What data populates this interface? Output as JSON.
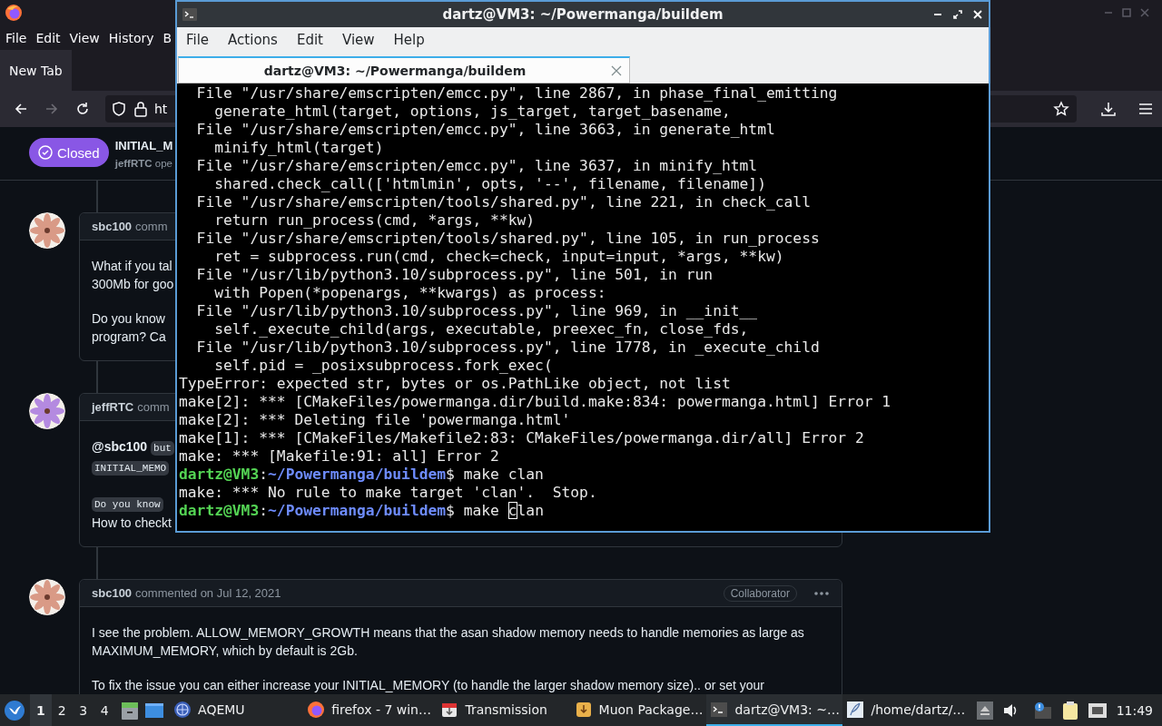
{
  "browser": {
    "menu": [
      "File",
      "Edit",
      "View",
      "History",
      "B"
    ],
    "tab": {
      "label": "New Tab",
      "selected": true
    },
    "nav": [
      {
        "kind": "back",
        "disabled": false
      },
      {
        "kind": "forward",
        "disabled": true
      },
      {
        "kind": "reload",
        "disabled": false
      }
    ],
    "address": {
      "value": "ht"
    },
    "issue": {
      "status": "Closed",
      "title": "INITIAL_M",
      "author": "jeffRTC",
      "meta": "ope"
    },
    "comments": [
      {
        "author": "sbc100",
        "action": "comm",
        "color": "#d99a86",
        "paragraphs": [
          [
            [
              {
                "kind": "text",
                "text": "What if you tal"
              }
            ],
            [
              {
                "kind": "text",
                "text": "300Mb for goo"
              }
            ]
          ],
          [
            [
              {
                "kind": "text",
                "text": "Do you know"
              }
            ],
            [
              {
                "kind": "text",
                "text": "program? Ca"
              }
            ]
          ]
        ]
      },
      {
        "author": "jeffRTC",
        "action": "comm",
        "color": "#b48ae0",
        "paragraphs": [
          [
            [
              {
                "kind": "mention",
                "text": "@sbc100"
              },
              {
                "kind": "code",
                "text": "but"
              }
            ],
            [
              {
                "kind": "code",
                "text": "INITIAL_MEMO"
              }
            ]
          ],
          [
            [
              {
                "kind": "code",
                "text": "Do you know"
              }
            ],
            [
              {
                "kind": "text",
                "text": "How to checkt"
              }
            ]
          ]
        ]
      },
      {
        "author": "sbc100",
        "action": "commented on Jul 12, 2021",
        "badge": "Collaborator",
        "color": "#d99a86",
        "paragraphs": [
          [
            [
              {
                "kind": "text",
                "text": "I see the problem. ALLOW_MEMORY_GROWTH means that the asan shadow memory needs to handle memories as large as"
              }
            ],
            [
              {
                "kind": "text",
                "text": "MAXIMUM_MEMORY, which by default is 2Gb."
              }
            ]
          ],
          [
            [
              {
                "kind": "text",
                "text": "To fix the issue you can either increase your INITIAL_MEMORY (to handle the larger shadow memory size).. or set your"
              }
            ]
          ]
        ]
      }
    ]
  },
  "terminal": {
    "title": "dartz@VM3: ~/Powermanga/buildem",
    "menu": [
      "File",
      "Actions",
      "Edit",
      "View",
      "Help"
    ],
    "tab": {
      "label": "dartz@VM3: ~/Powermanga/buildem",
      "selected": true
    },
    "lines": [
      {
        "kind": "output",
        "text": "  File \"/usr/share/emscripten/emcc.py\", line 2867, in phase_final_emitting"
      },
      {
        "kind": "output",
        "text": "    generate_html(target, options, js_target, target_basename,"
      },
      {
        "kind": "output",
        "text": "  File \"/usr/share/emscripten/emcc.py\", line 3663, in generate_html"
      },
      {
        "kind": "output",
        "text": "    minify_html(target)"
      },
      {
        "kind": "output",
        "text": "  File \"/usr/share/emscripten/emcc.py\", line 3637, in minify_html"
      },
      {
        "kind": "output",
        "text": "    shared.check_call(['htmlmin', opts, '--', filename, filename])"
      },
      {
        "kind": "output",
        "text": "  File \"/usr/share/emscripten/tools/shared.py\", line 221, in check_call"
      },
      {
        "kind": "output",
        "text": "    return run_process(cmd, *args, **kw)"
      },
      {
        "kind": "output",
        "text": "  File \"/usr/share/emscripten/tools/shared.py\", line 105, in run_process"
      },
      {
        "kind": "output",
        "text": "    ret = subprocess.run(cmd, check=check, input=input, *args, **kw)"
      },
      {
        "kind": "output",
        "text": "  File \"/usr/lib/python3.10/subprocess.py\", line 501, in run"
      },
      {
        "kind": "output",
        "text": "    with Popen(*popenargs, **kwargs) as process:"
      },
      {
        "kind": "output",
        "text": "  File \"/usr/lib/python3.10/subprocess.py\", line 969, in __init__"
      },
      {
        "kind": "output",
        "text": "    self._execute_child(args, executable, preexec_fn, close_fds,"
      },
      {
        "kind": "output",
        "text": "  File \"/usr/lib/python3.10/subprocess.py\", line 1778, in _execute_child"
      },
      {
        "kind": "output",
        "text": "    self.pid = _posixsubprocess.fork_exec("
      },
      {
        "kind": "output",
        "text": "TypeError: expected str, bytes or os.PathLike object, not list"
      },
      {
        "kind": "output",
        "text": "make[2]: *** [CMakeFiles/powermanga.dir/build.make:834: powermanga.html] Error 1"
      },
      {
        "kind": "output",
        "text": "make[2]: *** Deleting file 'powermanga.html'"
      },
      {
        "kind": "output",
        "text": "make[1]: *** [CMakeFiles/Makefile2:83: CMakeFiles/powermanga.dir/all] Error 2"
      },
      {
        "kind": "output",
        "text": "make: *** [Makefile:91: all] Error 2"
      },
      {
        "kind": "prompt",
        "user": "dartz@VM3",
        "separator": ":",
        "path": "~/Powermanga/buildem",
        "command": "$ make clan"
      },
      {
        "kind": "output",
        "text": "make: *** No rule to make target 'clan'.  Stop."
      },
      {
        "kind": "prompt",
        "user": "dartz@VM3",
        "separator": ":",
        "path": "~/Powermanga/buildem",
        "command": "$ make ",
        "cursor_char": "c",
        "command_rest": "lan"
      }
    ]
  },
  "taskbar": {
    "workspaces": [
      {
        "label": "1",
        "selected": true
      },
      {
        "label": "2",
        "selected": false
      },
      {
        "label": "3",
        "selected": false
      },
      {
        "label": "4",
        "selected": false
      }
    ],
    "tasks": [
      {
        "kind": "emulator",
        "label": "AQEMU",
        "selected": false
      },
      {
        "kind": "browser",
        "label": "firefox - 7 win…",
        "selected": false
      },
      {
        "kind": "torrent",
        "label": "Transmission",
        "selected": false
      },
      {
        "kind": "package",
        "label": "Muon Package…",
        "selected": false
      },
      {
        "kind": "terminal",
        "label": "dartz@VM3: ~…",
        "selected": true
      },
      {
        "kind": "files",
        "label": "/home/dartz/…",
        "selected": false
      }
    ],
    "clock": "11:49"
  }
}
